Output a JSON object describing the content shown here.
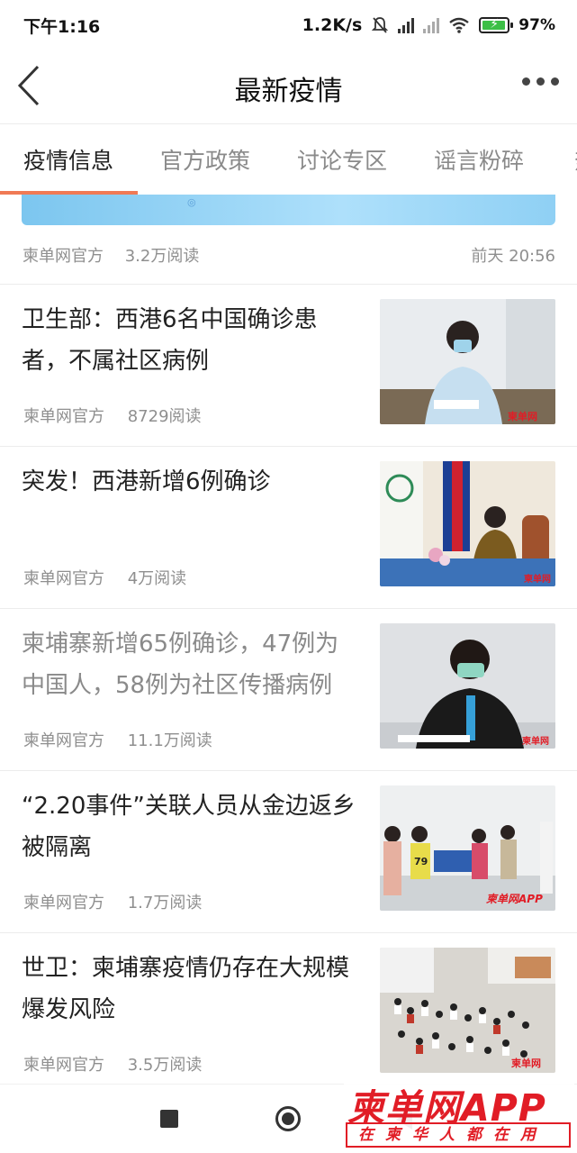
{
  "status_bar": {
    "time": "下午1:16",
    "net_speed": "1.2K/s",
    "battery": "97%"
  },
  "header": {
    "title": "最新疫情"
  },
  "tabs": [
    {
      "label": "疫情信息",
      "active": true
    },
    {
      "label": "官方政策",
      "active": false
    },
    {
      "label": "讨论专区",
      "active": false
    },
    {
      "label": "谣言粉碎",
      "active": false
    },
    {
      "label": "热",
      "active": false
    }
  ],
  "top_item": {
    "source": "柬单网官方",
    "reads": "3.2万阅读",
    "time": "前天 20:56"
  },
  "articles": [
    {
      "headline": "卫生部：西港6名中国确诊患者，不属社区病例",
      "source": "柬单网官方",
      "reads": "8729阅读",
      "read": false
    },
    {
      "headline": "突发！西港新增6例确诊",
      "source": "柬单网官方",
      "reads": "4万阅读",
      "read": false
    },
    {
      "headline": "柬埔寨新增65例确诊，47例为中国人，58例为社区传播病例",
      "source": "柬单网官方",
      "reads": "11.1万阅读",
      "read": true
    },
    {
      "headline": "“2.20事件”关联人员从金边返乡被隔离",
      "source": "柬单网官方",
      "reads": "1.7万阅读",
      "read": false
    },
    {
      "headline": "世卫：柬埔寨疫情仍存在大规模爆发风险",
      "source": "柬单网官方",
      "reads": "3.5万阅读",
      "read": false
    }
  ],
  "watermark": {
    "title": "柬单网APP",
    "slogan": "在柬华人都在用"
  },
  "colors": {
    "tab_indicator": "#f07a55",
    "brand_red": "#e11d26",
    "battery_green": "#3cbf46"
  }
}
